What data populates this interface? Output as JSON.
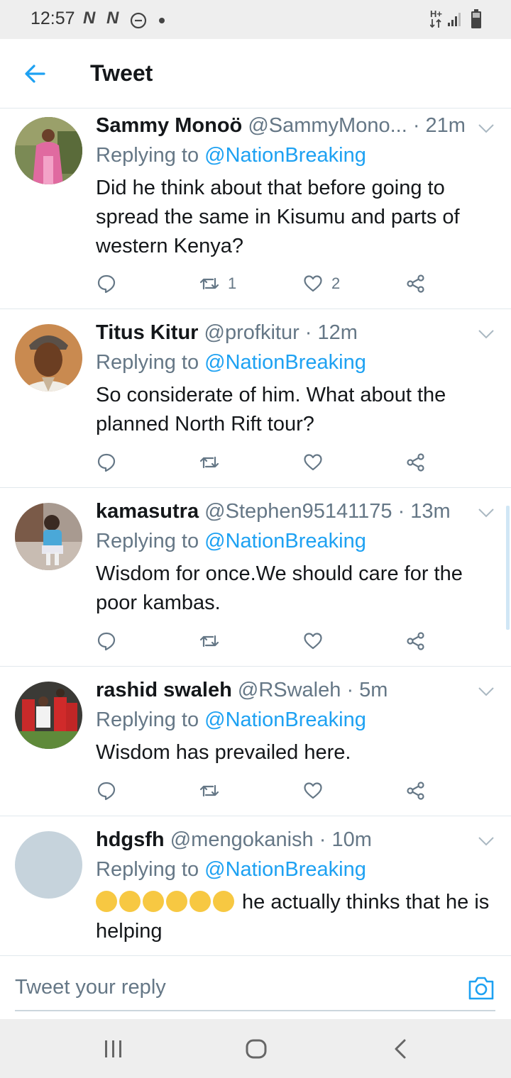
{
  "status_bar": {
    "time": "12:57",
    "notif1": "N",
    "notif2": "N",
    "network": "H+"
  },
  "header": {
    "title": "Tweet",
    "back_icon": "arrow-left-icon"
  },
  "colors": {
    "accent": "#1da1f2",
    "secondary_text": "#657786",
    "divider": "#e1e8ed"
  },
  "tweets": [
    {
      "name": "Sammy Monoö",
      "handle": "@SammyMono...",
      "time": "· 21m",
      "replying_prefix": "Replying to ",
      "replying_to": "@NationBreaking",
      "text": "Did he think about that before going to spread the same in Kisumu and parts of western Kenya?",
      "retweets": "1",
      "likes": "2"
    },
    {
      "name": "Titus Kitur",
      "handle": "@profkitur",
      "time": "· 12m",
      "replying_prefix": "Replying to ",
      "replying_to": "@NationBreaking",
      "text": "So considerate of him. What about the planned North Rift tour?",
      "retweets": "",
      "likes": ""
    },
    {
      "name": "kamasutra",
      "handle": "@Stephen95141175",
      "time": "· 13m",
      "replying_prefix": "Replying to ",
      "replying_to": "@NationBreaking",
      "text": "Wisdom for once.We should care for the poor kambas.",
      "retweets": "",
      "likes": ""
    },
    {
      "name": "rashid swaleh",
      "handle": "@RSwaleh",
      "time": "· 5m",
      "replying_prefix": "Replying to ",
      "replying_to": "@NationBreaking",
      "text": "Wisdom has prevailed here.",
      "retweets": "",
      "likes": ""
    },
    {
      "name": "hdgsfh",
      "handle": "@mengokanish",
      "time": "· 10m",
      "replying_prefix": "Replying to ",
      "replying_to": "@NationBreaking",
      "text_after_emoji": " he actually thinks that he is helping",
      "retweets": "",
      "likes": ""
    }
  ],
  "reply_bar": {
    "placeholder": "Tweet your reply",
    "camera_icon": "camera-icon"
  },
  "nav_bar": {
    "recents_icon": "recent-apps-icon",
    "home_icon": "home-icon",
    "back_icon": "back-chevron-icon"
  }
}
